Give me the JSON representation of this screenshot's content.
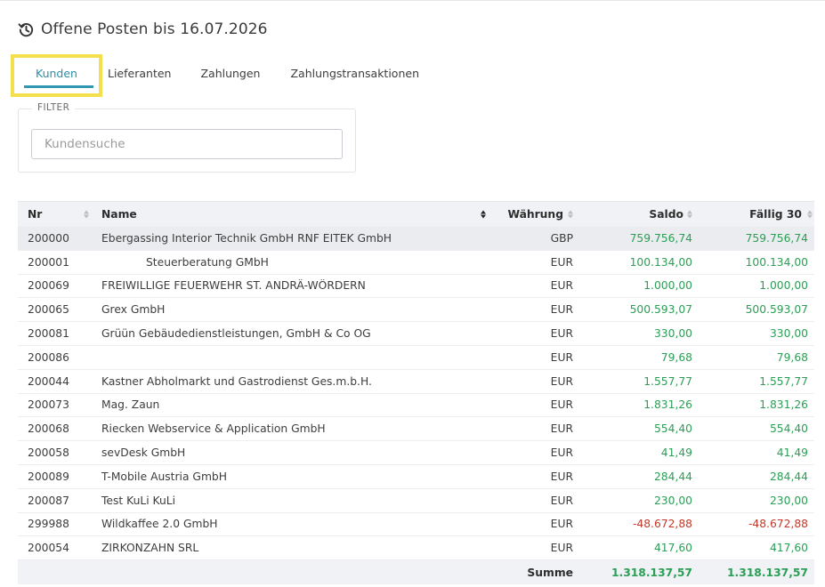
{
  "header": {
    "title": "Offene Posten bis 16.07.2026",
    "icon": "history-icon"
  },
  "tabs": [
    {
      "label": "Kunden",
      "active": true
    },
    {
      "label": "Lieferanten",
      "active": false
    },
    {
      "label": "Zahlungen",
      "active": false
    },
    {
      "label": "Zahlungstransaktionen",
      "active": false
    }
  ],
  "filter": {
    "legend": "FILTER",
    "placeholder": "Kundensuche",
    "value": ""
  },
  "table": {
    "columns": {
      "nr": "Nr",
      "name": "Name",
      "currency": "Währung",
      "saldo": "Saldo",
      "due": "Fällig 30"
    },
    "rows": [
      {
        "nr": "200000",
        "name": "Ebergassing Interior Technik GmbH RNF EITEK GmbH",
        "currency": "GBP",
        "saldo": "759.756,74",
        "due": "759.756,74"
      },
      {
        "nr": "200001",
        "name": "Steuerberatung GMbH",
        "currency": "EUR",
        "saldo": "100.134,00",
        "due": "100.134,00"
      },
      {
        "nr": "200069",
        "name": "FREIWILLIGE FEUERWEHR ST. ANDRÄ-WÖRDERN",
        "currency": "EUR",
        "saldo": "1.000,00",
        "due": "1.000,00"
      },
      {
        "nr": "200065",
        "name": "Grex GmbH",
        "currency": "EUR",
        "saldo": "500.593,07",
        "due": "500.593,07"
      },
      {
        "nr": "200081",
        "name": "Grüün Gebäudedienstleistungen, GmbH & Co OG",
        "currency": "EUR",
        "saldo": "330,00",
        "due": "330,00"
      },
      {
        "nr": "200086",
        "name": "",
        "currency": "EUR",
        "saldo": "79,68",
        "due": "79,68"
      },
      {
        "nr": "200044",
        "name": "Kastner Abholmarkt und Gastrodienst Ges.m.b.H.",
        "currency": "EUR",
        "saldo": "1.557,77",
        "due": "1.557,77"
      },
      {
        "nr": "200073",
        "name": "Mag. Zaun",
        "currency": "EUR",
        "saldo": "1.831,26",
        "due": "1.831,26"
      },
      {
        "nr": "200068",
        "name": "Riecken Webservice & Application GmbH",
        "currency": "EUR",
        "saldo": "554,40",
        "due": "554,40"
      },
      {
        "nr": "200058",
        "name": "sevDesk GmbH",
        "currency": "EUR",
        "saldo": "41,49",
        "due": "41,49"
      },
      {
        "nr": "200089",
        "name": "T-Mobile Austria GmbH",
        "currency": "EUR",
        "saldo": "284,44",
        "due": "284,44"
      },
      {
        "nr": "200087",
        "name": "Test KuLi KuLi",
        "currency": "EUR",
        "saldo": "230,00",
        "due": "230,00"
      },
      {
        "nr": "299988",
        "name": "Wildkaffee 2.0 GmbH",
        "currency": "EUR",
        "saldo": "-48.672,88",
        "due": "-48.672,88"
      },
      {
        "nr": "200054",
        "name": "ZIRKONZAHN SRL",
        "currency": "EUR",
        "saldo": "417,60",
        "due": "417,60"
      }
    ],
    "footer": {
      "label": "Summe",
      "saldo": "1.318.137,57",
      "due": "1.318.137,57"
    }
  },
  "colors": {
    "accent": "#2f97b1",
    "highlight": "#f4e04d",
    "positive": "#2c9e56",
    "negative": "#c0392b"
  }
}
